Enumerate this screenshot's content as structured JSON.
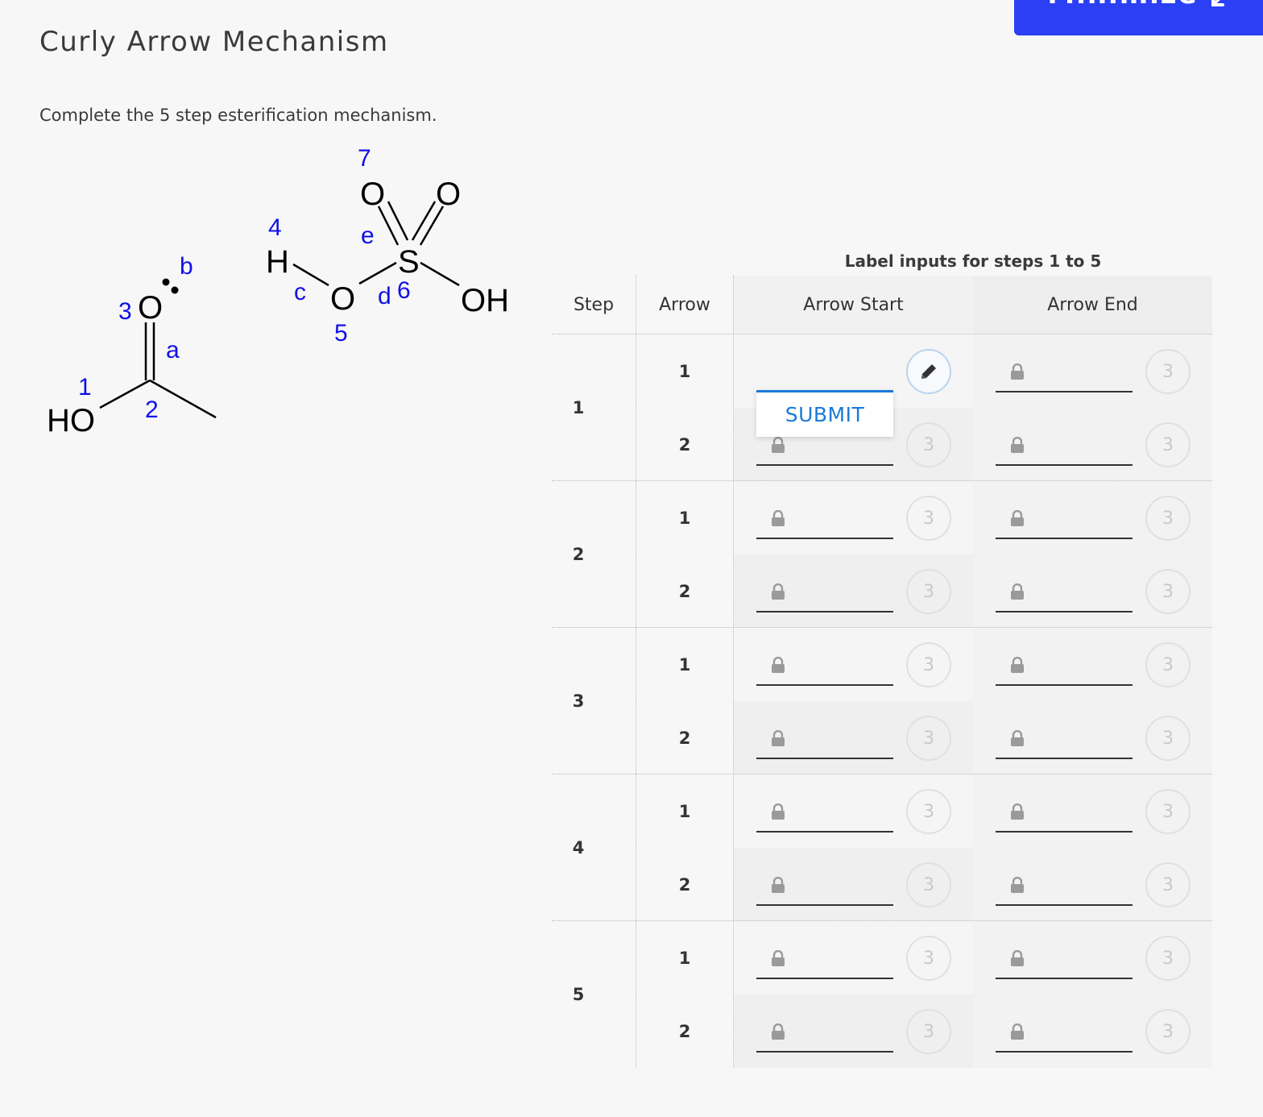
{
  "top_button": {
    "label": "Minimize",
    "icon": "minimize-icon",
    "color": "#2b3ff5"
  },
  "page": {
    "title": "Curly Arrow Mechanism",
    "instructions": "Complete the 5 step esterification mechanism."
  },
  "molecule": {
    "atoms": {
      "ho": "HO",
      "o_carbonyl": "O",
      "h": "H",
      "o_bridge": "O",
      "s": "S",
      "o_top_left": "O",
      "o_top_right": "O",
      "oh": "OH"
    },
    "atom_labels": {
      "n1": "1",
      "n2": "2",
      "n3": "3",
      "n4": "4",
      "n5": "5",
      "n6": "6",
      "n7": "7"
    },
    "bond_labels": {
      "a": "a",
      "b": "b",
      "c": "c",
      "d": "d",
      "e": "e"
    },
    "label_color": "#1010e8"
  },
  "table": {
    "caption": "Label inputs for steps 1 to 5",
    "headers": {
      "step": "Step",
      "arrow": "Arrow",
      "start": "Arrow Start",
      "end": "Arrow End"
    },
    "attempts_remaining": "3",
    "steps": [
      {
        "num": "1",
        "arrows": [
          {
            "num": "1",
            "start": {
              "locked": false,
              "value": ""
            },
            "end": {
              "locked": true,
              "attempts": "3"
            }
          },
          {
            "num": "2",
            "start": {
              "locked": true,
              "attempts": "3"
            },
            "end": {
              "locked": true,
              "attempts": "3"
            }
          }
        ]
      },
      {
        "num": "2",
        "arrows": [
          {
            "num": "1",
            "start": {
              "locked": true,
              "attempts": "3"
            },
            "end": {
              "locked": true,
              "attempts": "3"
            }
          },
          {
            "num": "2",
            "start": {
              "locked": true,
              "attempts": "3"
            },
            "end": {
              "locked": true,
              "attempts": "3"
            }
          }
        ]
      },
      {
        "num": "3",
        "arrows": [
          {
            "num": "1",
            "start": {
              "locked": true,
              "attempts": "3"
            },
            "end": {
              "locked": true,
              "attempts": "3"
            }
          },
          {
            "num": "2",
            "start": {
              "locked": true,
              "attempts": "3"
            },
            "end": {
              "locked": true,
              "attempts": "3"
            }
          }
        ]
      },
      {
        "num": "4",
        "arrows": [
          {
            "num": "1",
            "start": {
              "locked": true,
              "attempts": "3"
            },
            "end": {
              "locked": true,
              "attempts": "3"
            }
          },
          {
            "num": "2",
            "start": {
              "locked": true,
              "attempts": "3"
            },
            "end": {
              "locked": true,
              "attempts": "3"
            }
          }
        ]
      },
      {
        "num": "5",
        "arrows": [
          {
            "num": "1",
            "start": {
              "locked": true,
              "attempts": "3"
            },
            "end": {
              "locked": true,
              "attempts": "3"
            }
          },
          {
            "num": "2",
            "start": {
              "locked": true,
              "attempts": "3"
            },
            "end": {
              "locked": true,
              "attempts": "3"
            }
          }
        ]
      }
    ]
  },
  "popup": {
    "submit_label": "SUBMIT"
  },
  "colors": {
    "accent": "#1a7ad8",
    "brand": "#2b3ff5"
  }
}
